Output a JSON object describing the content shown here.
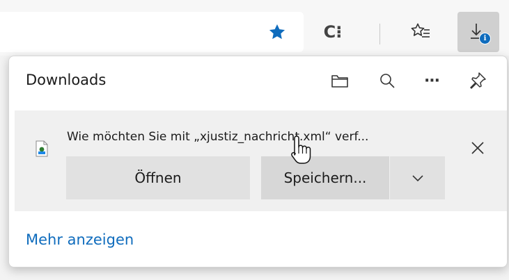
{
  "toolbar": {
    "icons": [
      "star-icon",
      "collections-icon",
      "favorites-icon",
      "downloads-icon"
    ],
    "collections_label": "C⁝",
    "download_badge": "i",
    "accent_color": "#0f6cbd",
    "active_button_bg": "#d0d0d0"
  },
  "downloads_panel": {
    "title": "Downloads",
    "header_icons": [
      "open-folder-icon",
      "search-icon",
      "more-options-icon",
      "pin-icon"
    ],
    "more_label": "···",
    "item": {
      "prompt": "Wie möchten Sie mit „xjustiz_nachricht.xml“ verf...",
      "file_icon": "xml-file-icon",
      "open_label": "Öffnen",
      "save_label": "Speichern...",
      "dropdown_icon": "chevron-down-icon",
      "close_icon": "close-icon"
    },
    "more_link": "Mehr anzeigen"
  },
  "colors": {
    "link": "#0f6cbd",
    "item_bg": "#f0f0f0",
    "button_bg": "#e1e1e1",
    "hover_button_bg": "#d7d7d7"
  }
}
